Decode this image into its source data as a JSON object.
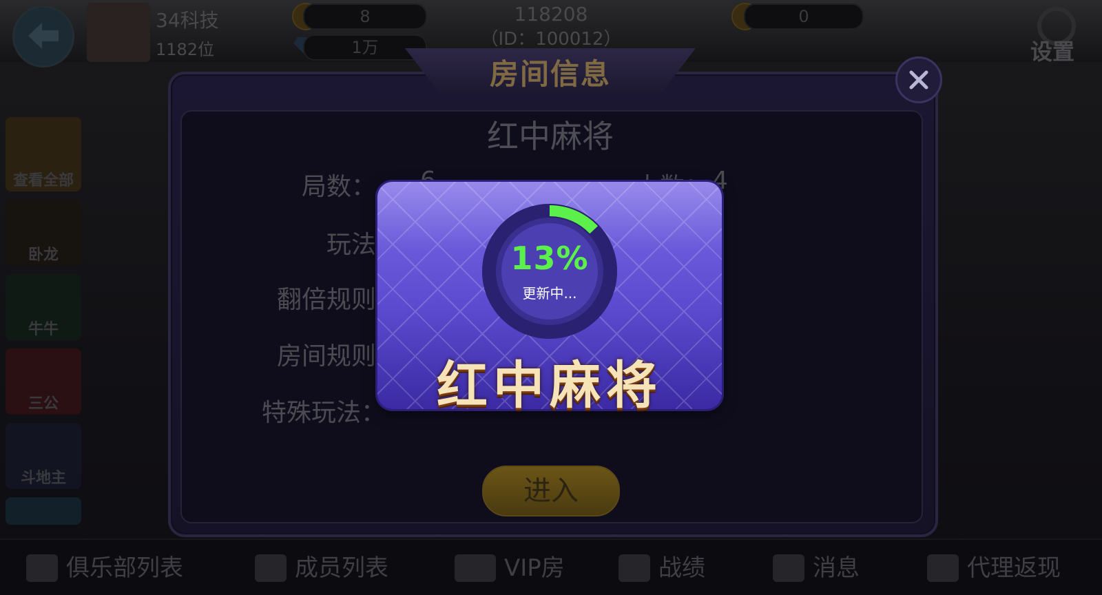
{
  "header": {
    "club_name": "34科技",
    "user_id": "1182位",
    "coins": "8",
    "diamonds": "1万",
    "room_number": "118208",
    "room_id_line": "（ID：100012）",
    "gold": "0",
    "settings_label": "设置"
  },
  "sidebar": {
    "items": [
      {
        "label": "查看全部"
      },
      {
        "label": "卧龙"
      },
      {
        "label": "牛牛"
      },
      {
        "label": "三公"
      },
      {
        "label": "斗地主"
      }
    ]
  },
  "dialog": {
    "title": "房间信息",
    "game_name": "红中麻将",
    "rounds_label": "局数：",
    "rounds_value": "6",
    "players_label": "人数：",
    "players_value": "4",
    "mode_label": "玩法",
    "multiplier_label": "翻倍规则",
    "room_rules_label": "房间规则",
    "special_label": "特殊玩法：",
    "enter_label": "进入"
  },
  "update": {
    "percent_text": "13%",
    "progress": 0.13,
    "status": "更新中...",
    "game_title": "红中麻将",
    "progress_color": "#5cf04a"
  },
  "bottom_nav": [
    {
      "label": "俱乐部列表",
      "icon": "flag-icon"
    },
    {
      "label": "成员列表",
      "icon": "members-icon"
    },
    {
      "label": "VIP房",
      "icon": "vip-icon"
    },
    {
      "label": "战绩",
      "icon": "trophy-icon"
    },
    {
      "label": "消息",
      "icon": "message-icon"
    },
    {
      "label": "代理返现",
      "icon": "agent-icon"
    }
  ]
}
